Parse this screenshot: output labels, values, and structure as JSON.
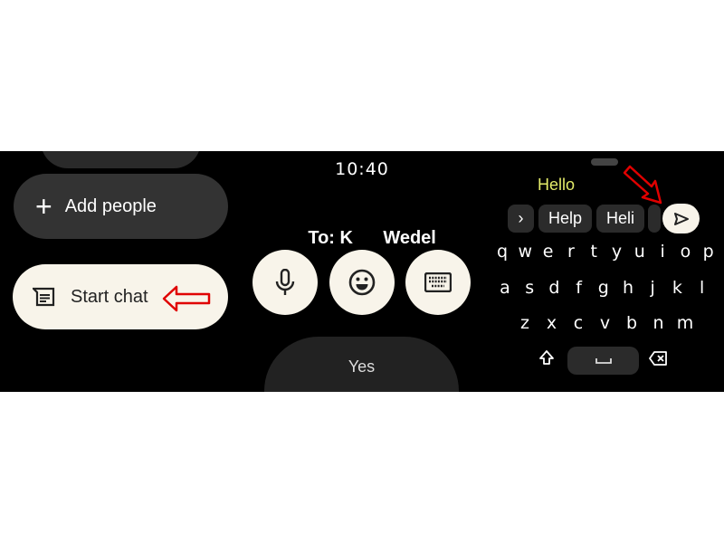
{
  "left_screen": {
    "add_people_label": "Add people",
    "start_chat_label": "Start chat",
    "icons": [
      "plus-icon",
      "chat-message-icon"
    ]
  },
  "middle_screen": {
    "time": "10:40",
    "recipient_prefix": "To: K",
    "recipient_name": "Wedel",
    "actions": [
      "microphone-icon",
      "emoji-icon",
      "keyboard-icon"
    ],
    "quick_reply": "Yes"
  },
  "right_screen": {
    "typed_text": "Hello",
    "suggestions": [
      "Help",
      "Heli"
    ],
    "keyboard_rows": [
      [
        "q",
        "w",
        "e",
        "r",
        "t",
        "y",
        "u",
        "i",
        "o",
        "p"
      ],
      [
        "a",
        "s",
        "d",
        "f",
        "g",
        "h",
        "j",
        "k",
        "l"
      ],
      [
        "z",
        "x",
        "c",
        "v",
        "b",
        "n",
        "m"
      ]
    ],
    "icons": [
      "chevron-right-icon",
      "send-icon",
      "shift-icon",
      "space-icon",
      "backspace-icon"
    ]
  },
  "colors": {
    "cream": "#f8f4ea",
    "typed_text": "#e4ec6a",
    "annotation_arrow": "#e00000",
    "pill_dark": "#333333"
  }
}
